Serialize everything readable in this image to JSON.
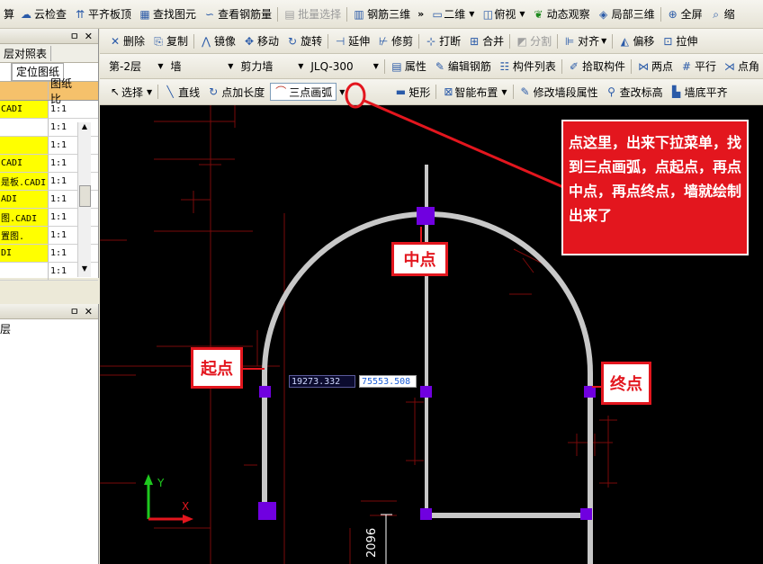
{
  "toolbar1": [
    {
      "name": "cloud-check",
      "label": "云检查",
      "icon": "☁"
    },
    {
      "name": "align-slab-top",
      "label": "平齐板顶",
      "icon": "⇈"
    },
    {
      "name": "find-element",
      "label": "查找图元",
      "icon": "▦"
    },
    {
      "name": "view-rebar",
      "label": "查看钢筋量",
      "icon": "∽"
    },
    {
      "name": "batch-select",
      "label": "批量选择",
      "icon": "▤",
      "disabled": true
    },
    {
      "name": "rebar-3d",
      "label": "钢筋三维",
      "icon": "▥"
    }
  ],
  "toolbar1_right": {
    "view2d": "二维",
    "top_view": "俯视",
    "dynamic_observe": "动态观察",
    "local_3d": "局部三维",
    "fullscreen": "全屏",
    "truncated": "缩"
  },
  "toolbar1_left_cut": "算",
  "toolbar2": [
    {
      "name": "delete",
      "label": "删除",
      "icon": "✕"
    },
    {
      "name": "copy",
      "label": "复制",
      "icon": "⎘"
    },
    {
      "name": "mirror",
      "label": "镜像",
      "icon": "⋀"
    },
    {
      "name": "move",
      "label": "移动",
      "icon": "✥"
    },
    {
      "name": "rotate",
      "label": "旋转",
      "icon": "↻"
    },
    {
      "name": "extend",
      "label": "延伸",
      "icon": "⊣"
    },
    {
      "name": "trim",
      "label": "修剪",
      "icon": "⊬"
    },
    {
      "name": "break",
      "label": "打断",
      "icon": "⊹"
    },
    {
      "name": "merge",
      "label": "合并",
      "icon": "⊞"
    },
    {
      "name": "split",
      "label": "分割",
      "icon": "◩",
      "disabled": true
    },
    {
      "name": "align",
      "label": "对齐",
      "icon": "⊫",
      "dropdown": true
    },
    {
      "name": "offset",
      "label": "偏移",
      "icon": "◭"
    },
    {
      "name": "stretch",
      "label": "拉伸",
      "icon": "⊡"
    }
  ],
  "toolbar3": {
    "floor": "第-2层",
    "category": "墙",
    "type": "剪力墙",
    "element": "JLQ-300 ",
    "buttons": [
      {
        "name": "properties",
        "label": "属性",
        "icon": "▤"
      },
      {
        "name": "edit-rebar",
        "label": "编辑钢筋",
        "icon": "✎"
      },
      {
        "name": "component-list",
        "label": "构件列表",
        "icon": "☷"
      },
      {
        "name": "pick-component",
        "label": "拾取构件",
        "icon": "✐"
      },
      {
        "name": "two-points",
        "label": "两点",
        "icon": "⋈"
      },
      {
        "name": "parallel",
        "label": "平行",
        "icon": "#"
      },
      {
        "name": "corner",
        "label": "点角",
        "icon": "⋊"
      }
    ]
  },
  "toolbar4": {
    "select": "选择",
    "line": "直线",
    "point_length": "点加长度",
    "three_point_arc": "三点画弧",
    "rectangle": "矩形",
    "smart_layout": "智能布置",
    "modify_segment": "修改墙段属性",
    "find_elevation": "查改标高",
    "wall_bottom_flat": "墙底平齐"
  },
  "panelA": {
    "controls": {
      "pin": "ㅁ",
      "close": "✕"
    },
    "tab1": "层对照表",
    "tab2": "定位图纸",
    "col_header": "图纸比",
    "rows": [
      {
        "name": "CADI",
        "ratio": "1:1",
        "hl": true
      },
      {
        "name": "",
        "ratio": "1:1",
        "hl": false
      },
      {
        "name": "",
        "ratio": "1:1",
        "hl": true
      },
      {
        "name": "CADI",
        "ratio": "1:1",
        "hl": true
      },
      {
        "name": "是板.CADI",
        "ratio": "1:1",
        "hl": true
      },
      {
        "name": "ADI",
        "ratio": "1:1",
        "hl": true
      },
      {
        "name": "图.CADI",
        "ratio": "1:1",
        "hl": true
      },
      {
        "name": "置图.",
        "ratio": "1:1",
        "hl": true
      },
      {
        "name": "DI",
        "ratio": "1:1",
        "hl": true
      },
      {
        "name": "",
        "ratio": "1:1",
        "hl": false
      }
    ]
  },
  "panelB": {
    "controls": {
      "pin": "ㅁ",
      "close": "✕"
    },
    "text": "层"
  },
  "canvas": {
    "coord_x": "19273.332",
    "coord_y": "75553.508",
    "dimension": "2096",
    "axis_y": "Y",
    "axis_x": "X"
  },
  "annotations": {
    "note": "点这里，出来下拉菜单，找到三点画弧，点起点，再点中点，再点终点，墙就绘制出来了",
    "mid_point": "中点",
    "start_point": "起点",
    "end_point": "终点"
  },
  "colors": {
    "annotation": "#e3161e",
    "wall": "#c8c8c8",
    "grip": "#6f00e0",
    "canvas": "#000000",
    "cad_line": "#8b0000"
  }
}
